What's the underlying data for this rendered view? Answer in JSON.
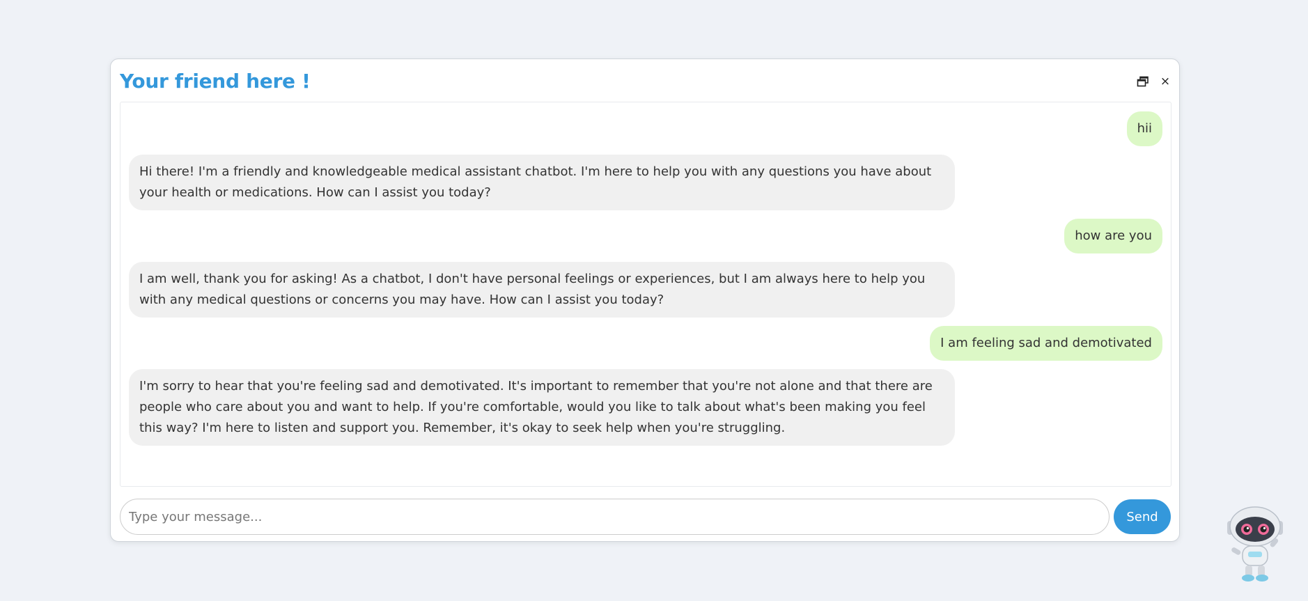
{
  "header": {
    "title": "Your friend here !",
    "restore_icon": "window-restore-icon",
    "close_glyph": "×"
  },
  "messages": [
    {
      "role": "user",
      "text": "hii"
    },
    {
      "role": "bot",
      "text": "Hi there! I'm a friendly and knowledgeable medical assistant chatbot. I'm here to help you with any questions you have about your health or medications. How can I assist you today?"
    },
    {
      "role": "user",
      "text": "how are you"
    },
    {
      "role": "bot",
      "text": "I am well, thank you for asking! As a chatbot, I don't have personal feelings or experiences, but I am always here to help you with any medical questions or concerns you may have. How can I assist you today?"
    },
    {
      "role": "user",
      "text": "I am feeling sad and demotivated"
    },
    {
      "role": "bot",
      "text": "I'm sorry to hear that you're feeling sad and demotivated. It's important to remember that you're not alone and that there are people who care about you and want to help. If you're comfortable, would you like to talk about what's been making you feel this way? I'm here to listen and support you. Remember, it's okay to seek help when you're struggling."
    }
  ],
  "input": {
    "placeholder": "Type your message...",
    "value": "",
    "send_label": "Send"
  },
  "launcher": {
    "icon": "robot-mascot-icon"
  },
  "colors": {
    "accent": "#3498db",
    "user_bubble": "#dcf8c6",
    "bot_bubble": "#f0f0f0",
    "page_background": "#eff2f7"
  }
}
